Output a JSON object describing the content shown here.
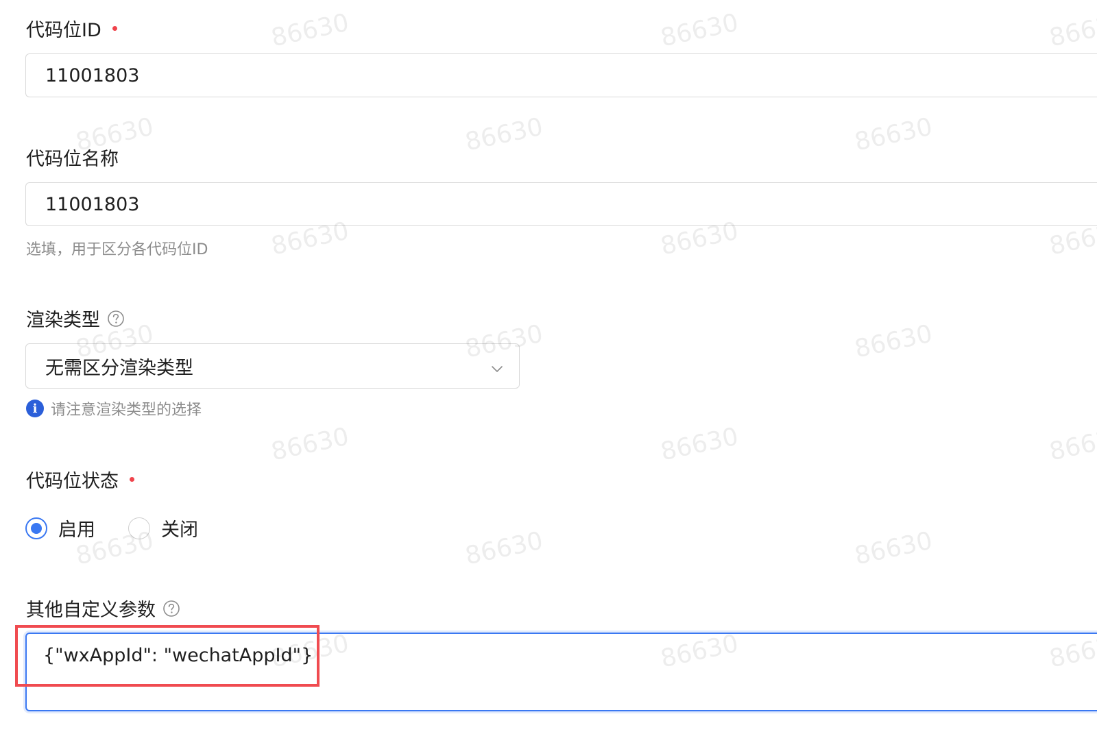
{
  "watermark_text": "86630",
  "fields": {
    "ad_slot_id": {
      "label": "代码位ID",
      "value": "11001803"
    },
    "ad_slot_name": {
      "label": "代码位名称",
      "value": "11001803",
      "hint": "选填，用于区分各代码位ID"
    },
    "render_type": {
      "label": "渲染类型",
      "selected": "无需区分渲染类型",
      "hint": "请注意渲染类型的选择"
    },
    "slot_status": {
      "label": "代码位状态",
      "options": [
        "启用",
        "关闭"
      ],
      "selected": "启用"
    },
    "custom_params": {
      "label": "其他自定义参数",
      "value": "{\"wxAppId\": \"wechatAppId\"}"
    }
  },
  "colors": {
    "required": "#f0434b",
    "accent": "#3a78f2",
    "annotation": "#f04b50",
    "info": "#2b5fd9"
  },
  "icons": {
    "help": "question-circle-icon",
    "select_arrow": "chevron-down-icon",
    "info": "info-circle-icon"
  }
}
